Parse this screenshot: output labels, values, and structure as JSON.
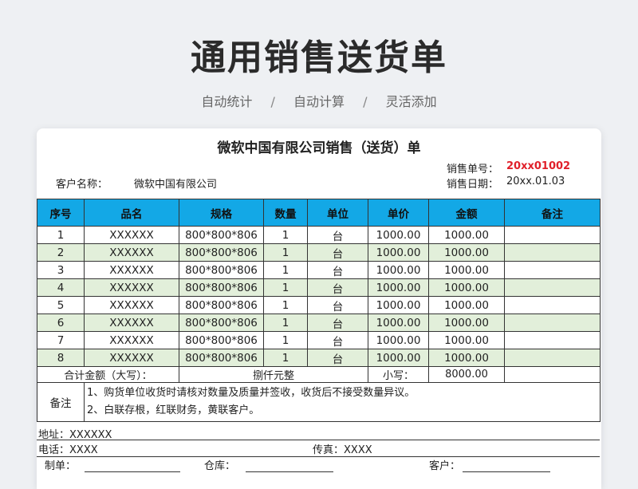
{
  "header": {
    "title": "通用销售送货单",
    "features": [
      "自动统计",
      "自动计算",
      "灵活添加"
    ],
    "separator": "/"
  },
  "document": {
    "title": "微软中国有限公司销售（送货）单",
    "order_no_label": "销售单号：",
    "order_no_value": "20xx01002",
    "customer_label": "客户名称：",
    "customer_value": "微软中国有限公司",
    "date_label": "销售日期：",
    "date_value": "20xx.01.03"
  },
  "table": {
    "columns": [
      "序号",
      "品名",
      "规格",
      "数量",
      "单位",
      "单价",
      "金额",
      "备注"
    ],
    "rows": [
      [
        "1",
        "XXXXXX",
        "800*800*806",
        "1",
        "台",
        "1000.00",
        "1000.00",
        ""
      ],
      [
        "2",
        "XXXXXX",
        "800*800*806",
        "1",
        "台",
        "1000.00",
        "1000.00",
        ""
      ],
      [
        "3",
        "XXXXXX",
        "800*800*806",
        "1",
        "台",
        "1000.00",
        "1000.00",
        ""
      ],
      [
        "4",
        "XXXXXX",
        "800*800*806",
        "1",
        "台",
        "1000.00",
        "1000.00",
        ""
      ],
      [
        "5",
        "XXXXXX",
        "800*800*806",
        "1",
        "台",
        "1000.00",
        "1000.00",
        ""
      ],
      [
        "6",
        "XXXXXX",
        "800*800*806",
        "1",
        "台",
        "1000.00",
        "1000.00",
        ""
      ],
      [
        "7",
        "XXXXXX",
        "800*800*806",
        "1",
        "台",
        "1000.00",
        "1000.00",
        ""
      ],
      [
        "8",
        "XXXXXX",
        "800*800*806",
        "1",
        "台",
        "1000.00",
        "1000.00",
        ""
      ]
    ],
    "total_label": "合计金额（大写）：",
    "total_words": "捌仟元整",
    "small_label": "小写：",
    "small_value": "8000.00",
    "notes_label": "备注",
    "notes": [
      "1、购货单位收货时请核对数量及质量并签收，收货后不接受数量异议。",
      "2、白联存根，红联财务，黄联客户。"
    ]
  },
  "footer": {
    "address_label": "地址：",
    "address_value": "XXXXXX",
    "phone_label": "电话：",
    "phone_value": "XXXX",
    "fax_label": "传真：",
    "fax_value": "XXXX",
    "maker_label": "制单：",
    "warehouse_label": "仓库：",
    "customer_label": "客户："
  },
  "colors": {
    "header_fill": "#13a8e6",
    "stripe_fill": "#e2efda",
    "order_no": "#e0202a"
  }
}
